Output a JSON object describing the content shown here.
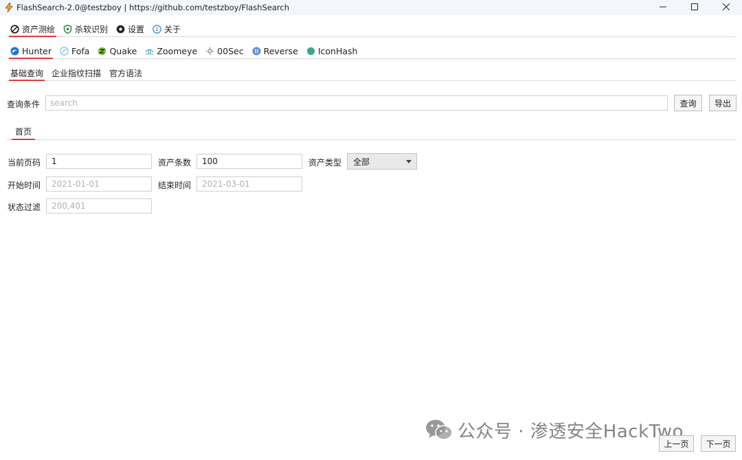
{
  "window": {
    "title": "FlashSearch-2.0@testzboy | https://github.com/testzboy/FlashSearch"
  },
  "main_tabs": [
    {
      "label": "资产测绘",
      "icon": "compass-icon",
      "active": true
    },
    {
      "label": "杀软识别",
      "icon": "shield-icon",
      "active": false
    },
    {
      "label": "设置",
      "icon": "gear-icon",
      "active": false
    },
    {
      "label": "关于",
      "icon": "info-icon",
      "active": false
    }
  ],
  "engine_tabs": [
    {
      "label": "Hunter",
      "icon": "hunter-icon",
      "active": true
    },
    {
      "label": "Fofa",
      "icon": "fofa-icon",
      "active": false
    },
    {
      "label": "Quake",
      "icon": "quake-icon",
      "active": false
    },
    {
      "label": "Zoomeye",
      "icon": "zoomeye-icon",
      "active": false
    },
    {
      "label": "00Sec",
      "icon": "sun-icon",
      "active": false
    },
    {
      "label": "Reverse",
      "icon": "reverse-icon",
      "active": false
    },
    {
      "label": "IconHash",
      "icon": "iconhash-icon",
      "active": false
    }
  ],
  "query_tabs": [
    {
      "label": "基础查询",
      "active": true
    },
    {
      "label": "企业指纹扫描",
      "active": false
    },
    {
      "label": "官方语法",
      "active": false
    }
  ],
  "search": {
    "label": "查询条件",
    "placeholder": "search",
    "value": "",
    "query_button": "查询",
    "export_button": "导出"
  },
  "result_tabs": [
    {
      "label": "首页",
      "active": true
    }
  ],
  "form": {
    "page_label": "当前页码",
    "page_value": "1",
    "count_label": "资产条数",
    "count_value": "100",
    "type_label": "资产类型",
    "type_value": "全部",
    "start_label": "开始时间",
    "start_placeholder": "2021-01-01",
    "end_label": "结束时间",
    "end_placeholder": "2021-03-01",
    "status_label": "状态过滤",
    "status_placeholder": "200,401"
  },
  "pagination": {
    "prev_label": "上一页",
    "next_label": "下一页"
  },
  "watermark": {
    "text": "公众号 · 渗透安全HackTwo"
  },
  "colors": {
    "active_underline": "#e03a3a",
    "titlebar_bg": "#f3f6fb",
    "border": "#cfcfcf"
  }
}
